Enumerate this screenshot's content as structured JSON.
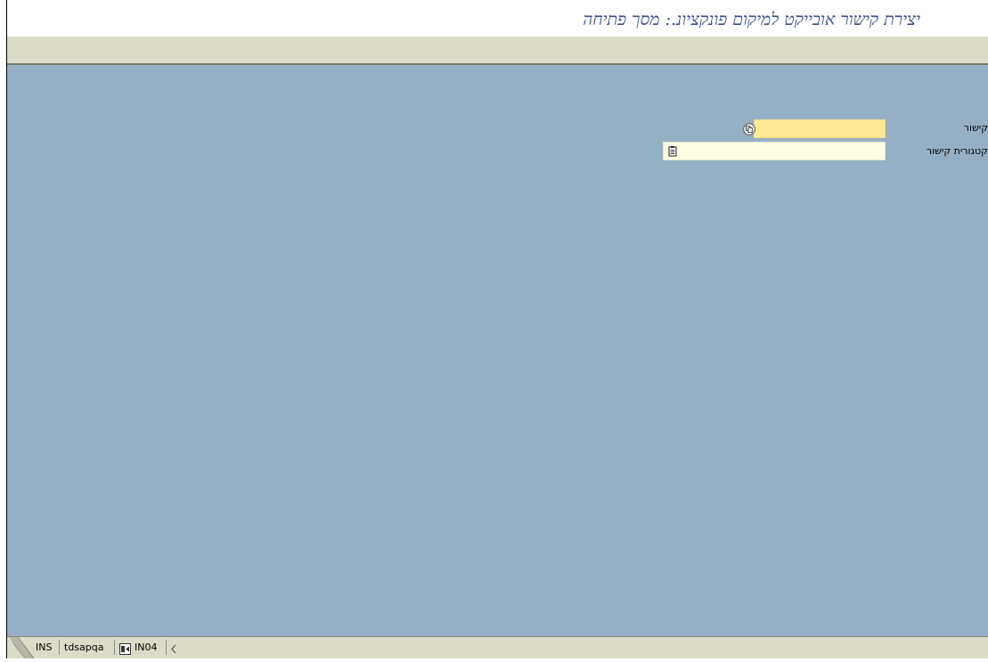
{
  "window": {
    "title": "יצירת קישור אובייקט למיקום פונקציונ.: מסך פתיחה"
  },
  "form": {
    "link_field": {
      "label": "קישור",
      "value": "",
      "required": true,
      "icon": "copy-icon"
    },
    "link_category_field": {
      "label": "קטגורית קישור",
      "value": "",
      "icon": "clipboard-icon"
    }
  },
  "statusbar": {
    "mode": "INS",
    "system": "tdsapqa",
    "session": "IN04",
    "session_icon": "session-icon",
    "arrow_icon": "left-arrow-icon"
  },
  "colors": {
    "title_text": "#3a4e8c",
    "workarea_bg": "#95b0c4",
    "toolbar_bg": "#dcdbc8",
    "required_field_bg": "#ffe999",
    "normal_field_bg": "#fffde6"
  }
}
